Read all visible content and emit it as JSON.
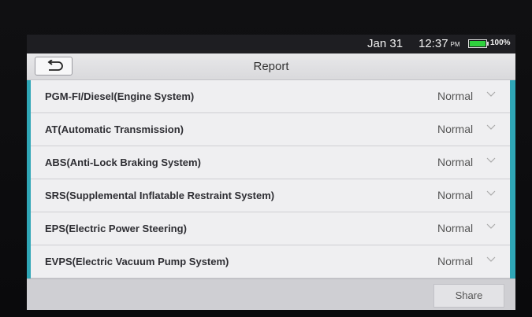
{
  "status": {
    "date": "Jan 31",
    "time": "12:37",
    "ampm": "PM",
    "battery_percent": "100%",
    "battery_color": "#2fd13e"
  },
  "header": {
    "title": "Report",
    "back_icon": "return-arrow-icon"
  },
  "report": {
    "accent_color": "#2fa6b6",
    "rows": [
      {
        "system": "PGM-FI/Diesel(Engine System)",
        "status": "Normal"
      },
      {
        "system": "AT(Automatic Transmission)",
        "status": "Normal"
      },
      {
        "system": "ABS(Anti-Lock Braking System)",
        "status": "Normal"
      },
      {
        "system": "SRS(Supplemental Inflatable Restraint System)",
        "status": "Normal"
      },
      {
        "system": "EPS(Electric Power Steering)",
        "status": "Normal"
      },
      {
        "system": "EVPS(Electric Vacuum Pump System)",
        "status": "Normal"
      }
    ]
  },
  "footer": {
    "share_label": "Share"
  }
}
